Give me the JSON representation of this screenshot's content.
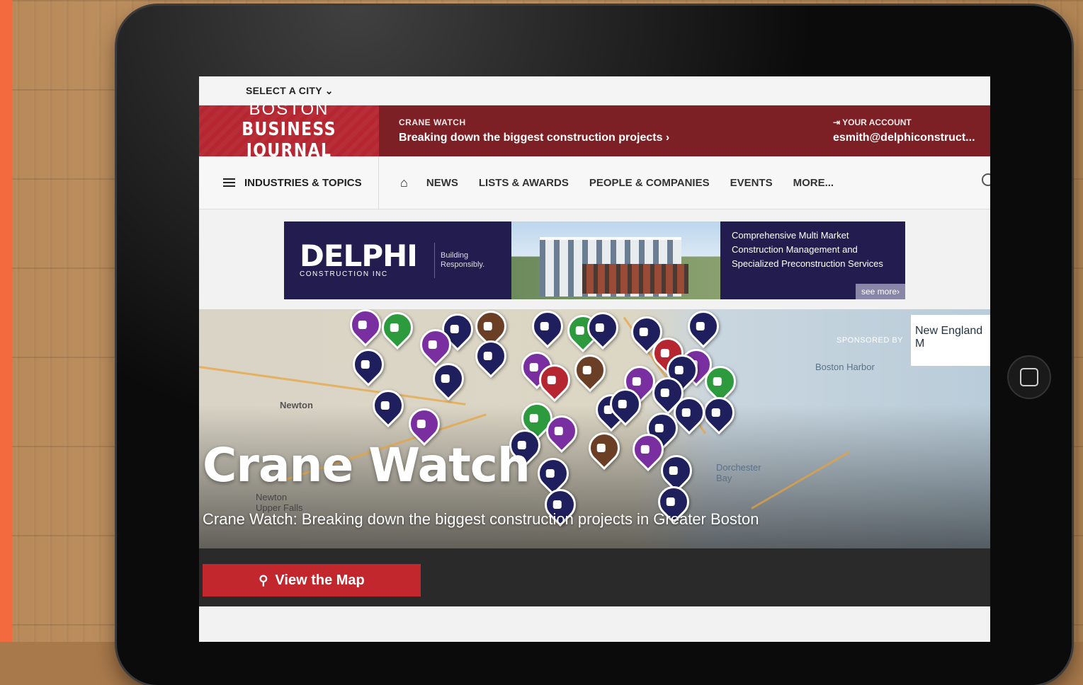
{
  "city_bar": {
    "select_city": "SELECT A CITY ⌄"
  },
  "header": {
    "logo_line1": "BOSTON",
    "logo_line2": "BUSINESS JOURNAL",
    "section_label": "CRANE WATCH",
    "section_headline": "Breaking down the biggest construction projects ›",
    "account_label": "⇥ YOUR ACCOUNT",
    "account_email": "esmith@delphiconstruct..."
  },
  "nav": {
    "topics": "INDUSTRIES & TOPICS",
    "items": [
      "NEWS",
      "LISTS & AWARDS",
      "PEOPLE & COMPANIES",
      "EVENTS",
      "MORE..."
    ]
  },
  "ad": {
    "brand": "DELPHI",
    "brand_sub": "CONSTRUCTION INC",
    "tagline": "Building Responsibly.",
    "copy": "Comprehensive Multi Market Construction Management and Specialized Preconstruction Services",
    "see_more": "see more›"
  },
  "hero": {
    "title": "Crane Watch",
    "subtitle": "Crane Watch: Breaking down the biggest construction projects in Greater Boston",
    "sponsored_by": "SPONSORED BY",
    "sponsor": "New England M",
    "map_labels": [
      "Newton",
      "Boston Harbor",
      "Dorchester Bay",
      "Newton Upper Falls"
    ],
    "view_map": "View the Map"
  },
  "colors": {
    "brand_red": "#b52630",
    "header_bg": "#7d2025",
    "ad_bg": "#231d4f",
    "button_red": "#c1272d"
  }
}
